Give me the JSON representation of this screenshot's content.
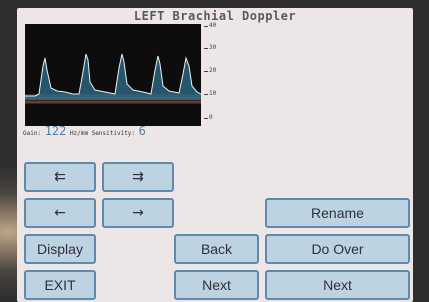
{
  "header": {
    "title": "LEFT Brachial Doppler"
  },
  "scale": {
    "labels": [
      "40",
      "30",
      "20",
      "10",
      "0"
    ]
  },
  "readout": {
    "gain_label": "Gain:",
    "gain_value": "122",
    "units": "Hz/mm",
    "sensitivity_label": "Sensitivity:",
    "sensitivity_value": "6"
  },
  "buttons": {
    "fast_back": "⇇",
    "fast_forward": "⇉",
    "step_back": "←",
    "step_forward": "→",
    "rename": "Rename",
    "display": "Display",
    "back": "Back",
    "do_over": "Do Over",
    "exit": "EXIT",
    "next_left": "Next",
    "next_right": "Next"
  }
}
